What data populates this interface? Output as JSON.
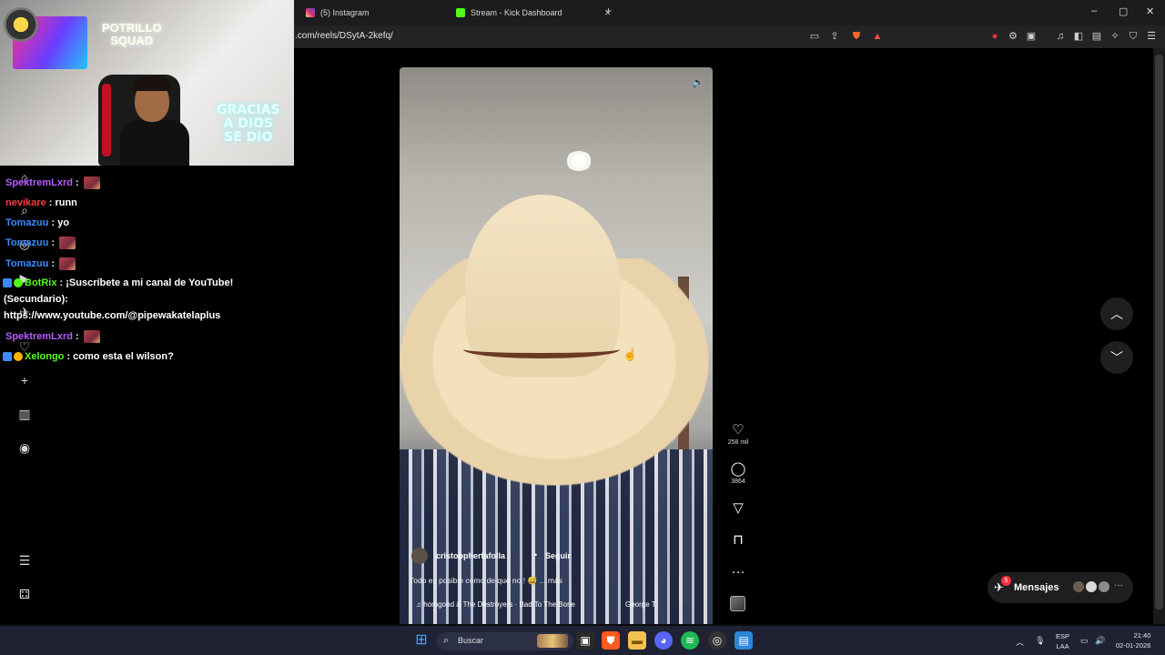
{
  "browser": {
    "tabs": [
      {
        "label": "(5) Instagram",
        "icon": "instagram-icon",
        "color": "#e1306c"
      },
      {
        "label": "Stream - Kick Dashboard",
        "icon": "kick-icon",
        "color": "#53fc18"
      }
    ],
    "new_tab": "+",
    "url": ".com/reels/DSytA-2kefq/",
    "window_controls": {
      "minimize": "–",
      "maximize": "▢",
      "close": "✕"
    }
  },
  "webcam": {
    "neon_sign": "GRACIAS\nA DIOS\nSE DIO",
    "neon_wall": "POTRILLO\nSQUAD"
  },
  "chat": {
    "messages": [
      {
        "user": "SpektremLxrd",
        "sep": " : ",
        "text": "",
        "color": "#b65cff",
        "emote": true
      },
      {
        "user": "nevikare",
        "sep": " : ",
        "text": "runn",
        "color": "#ff3b3b",
        "emote": false
      },
      {
        "user": "Tomazuu",
        "sep": " : ",
        "text": "yo",
        "color": "#3a8bff",
        "emote": false
      },
      {
        "user": "Tomazuu",
        "sep": " : ",
        "text": "",
        "color": "#3a8bff",
        "emote": true
      },
      {
        "user": "Tomazuu",
        "sep": " : ",
        "text": "",
        "color": "#3a8bff",
        "emote": true
      },
      {
        "user": "BotRix",
        "sep": " : ",
        "text": "¡Suscríbete a mi canal de YouTube!",
        "color": "#53fc18",
        "emote": false
      },
      {
        "user": "",
        "sep": "",
        "text": "(Secundario):",
        "color": "#ffffff",
        "emote": false
      },
      {
        "user": "",
        "sep": "",
        "text": "https://www.youtube.com/@pipewakatelaplus",
        "color": "#ffffff",
        "emote": false
      },
      {
        "user": "SpektremLxrd",
        "sep": " : ",
        "text": "",
        "color": "#b65cff",
        "emote": true
      },
      {
        "user": "Xelongo",
        "sep": " : ",
        "text": "como esta el wilson?",
        "color": "#53fc18",
        "emote": false
      }
    ]
  },
  "reel": {
    "username": "cristopphertafolla",
    "follow_dot": "•",
    "follow": "Seguir",
    "caption": "Todo es posible como de que no ! 😅 ... más",
    "music": "♫  horogood & The Destroyers · Bad To The Bone",
    "music_tag": "George T",
    "actions": {
      "like_count": "258 mil",
      "comment_count": "3864"
    }
  },
  "messages_pill": {
    "label": "Mensajes",
    "badge": "5"
  },
  "taskbar": {
    "search_label": "Buscar",
    "lang": "ESP",
    "layout": "LAA",
    "time": "21:40",
    "date": "02-01-2026"
  },
  "colors": {
    "page_bg": "#000000",
    "chrome_bg": "#1c1c1e",
    "taskbar_bg": "#1f2233",
    "kick_green": "#53fc18",
    "ig_red": "#ff3040"
  }
}
